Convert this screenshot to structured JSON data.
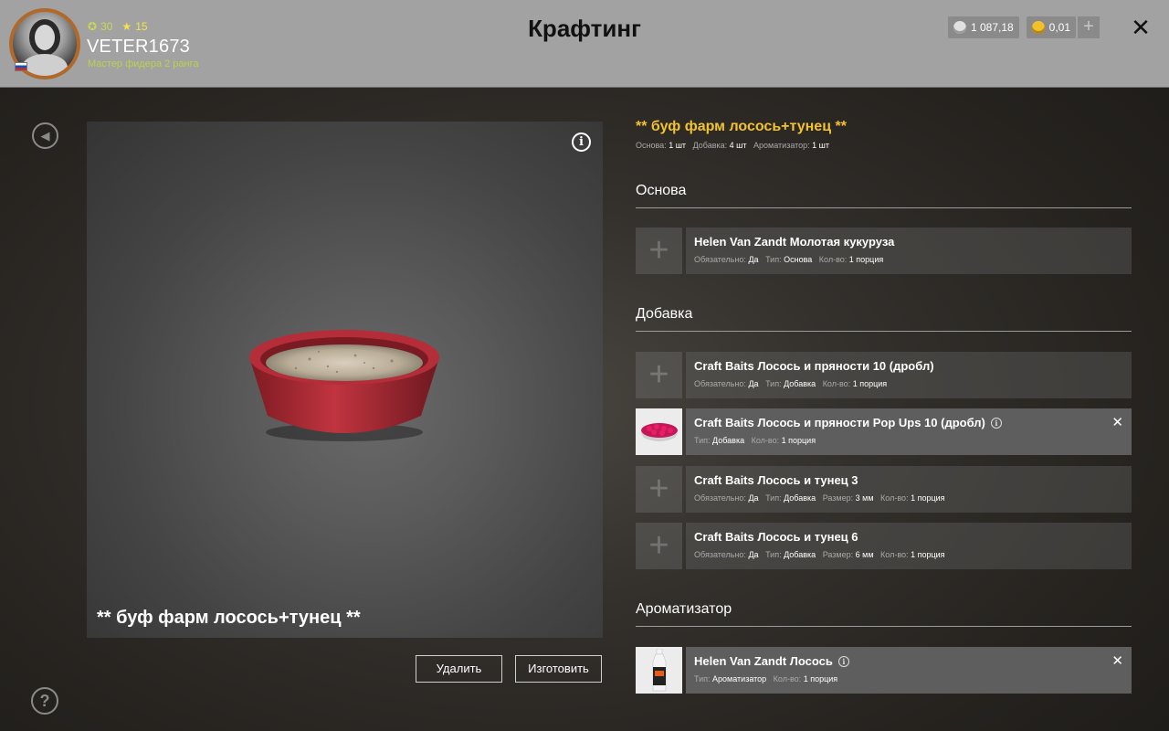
{
  "header": {
    "title": "Крафтинг",
    "player": {
      "name": "VETER1673",
      "rank": "Мастер фидера 2 ранга",
      "level": "30",
      "stars": "15"
    },
    "currency": {
      "silver": "1 087,18",
      "gold": "0,01"
    },
    "add_symbol": "+",
    "close_symbol": "✕"
  },
  "preview": {
    "name": "** буф фарм лосось+тунец **",
    "info_symbol": "i"
  },
  "actions": {
    "delete_label": "Удалить",
    "craft_label": "Изготовить"
  },
  "recipe": {
    "title": "** буф фарм лосось+тунец **",
    "summary": [
      {
        "label": "Основа:",
        "value": "1 шт"
      },
      {
        "label": "Добавка:",
        "value": "4 шт"
      },
      {
        "label": "Ароматизатор:",
        "value": "1 шт"
      }
    ]
  },
  "sections": {
    "base": {
      "title": "Основа",
      "slots": [
        {
          "name": "Helen Van Zandt Молотая кукуруза",
          "props": [
            {
              "label": "Обязательно:",
              "value": "Да"
            },
            {
              "label": "Тип:",
              "value": "Основа"
            },
            {
              "label": "Кол-во:",
              "value": "1 порция"
            }
          ]
        }
      ]
    },
    "additive": {
      "title": "Добавка",
      "slots": [
        {
          "name": "Craft Baits Лосось и пряности 10 (дробл)",
          "props": [
            {
              "label": "Обязательно:",
              "value": "Да"
            },
            {
              "label": "Тип:",
              "value": "Добавка"
            },
            {
              "label": "Кол-во:",
              "value": "1 порция"
            }
          ]
        },
        {
          "name": "Craft Baits Лосось и пряности Pop Ups 10 (дробл)",
          "props": [
            {
              "label": "Тип:",
              "value": "Добавка"
            },
            {
              "label": "Кол-во:",
              "value": "1 порция"
            }
          ]
        },
        {
          "name": "Craft Baits Лосось и тунец 3",
          "props": [
            {
              "label": "Обязательно:",
              "value": "Да"
            },
            {
              "label": "Тип:",
              "value": "Добавка"
            },
            {
              "label": "Размер:",
              "value": "3 мм"
            },
            {
              "label": "Кол-во:",
              "value": "1 порция"
            }
          ]
        },
        {
          "name": "Craft Baits Лосось и тунец 6",
          "props": [
            {
              "label": "Обязательно:",
              "value": "Да"
            },
            {
              "label": "Тип:",
              "value": "Добавка"
            },
            {
              "label": "Размер:",
              "value": "6 мм"
            },
            {
              "label": "Кол-во:",
              "value": "1 порция"
            }
          ]
        }
      ]
    },
    "flavor": {
      "title": "Ароматизатор",
      "slots": [
        {
          "name": "Helen Van Zandt Лосось",
          "props": [
            {
              "label": "Тип:",
              "value": "Ароматизатор"
            },
            {
              "label": "Кол-во:",
              "value": "1 порция"
            }
          ]
        }
      ]
    }
  },
  "icons": {
    "empty_slot": "+",
    "remove": "✕",
    "info": "i",
    "back": "◀",
    "help": "?"
  },
  "colors": {
    "accent_title": "#f2c230",
    "rank": "#b9d24a",
    "level": "#c8d94f",
    "stars": "#f4e04a"
  }
}
